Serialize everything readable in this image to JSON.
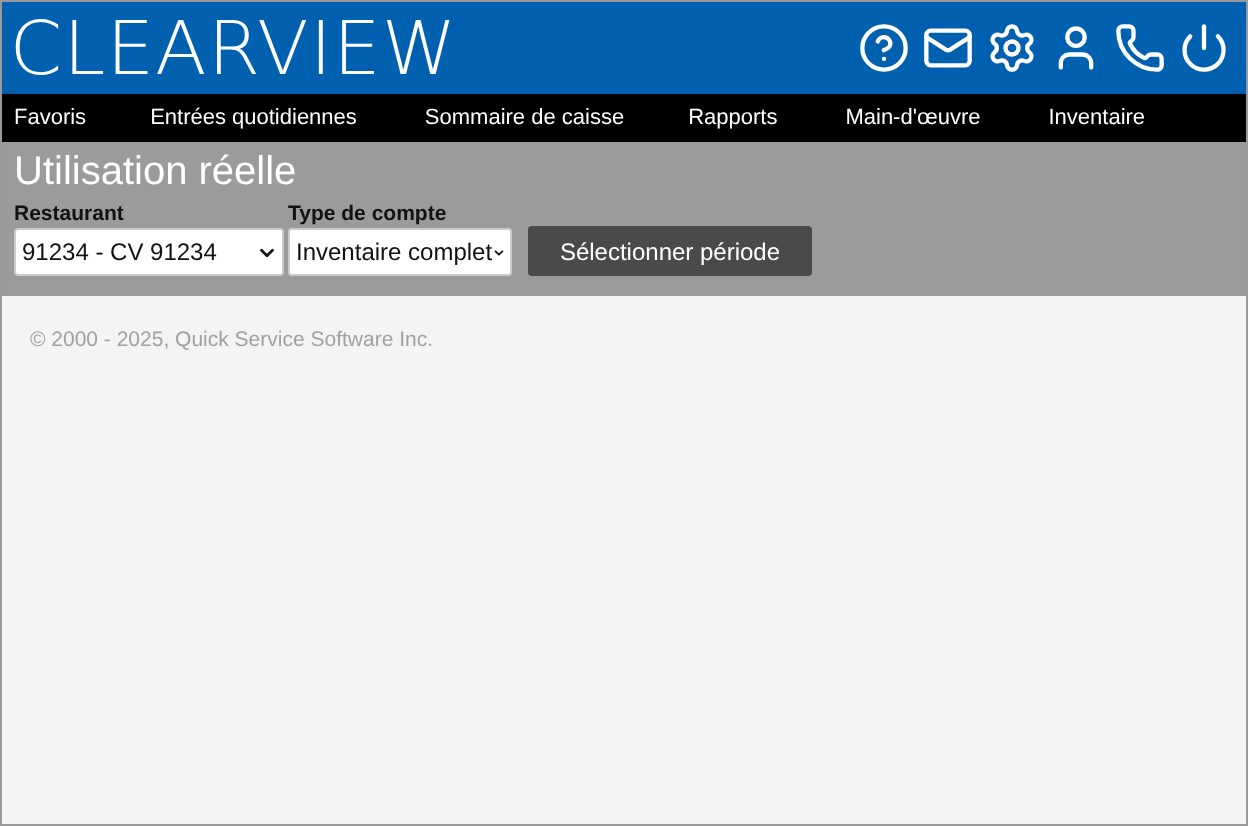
{
  "header": {
    "logo": "CLEARVIEW"
  },
  "nav": [
    {
      "label": "Favoris"
    },
    {
      "label": "Entrées quotidiennes"
    },
    {
      "label": "Sommaire de caisse"
    },
    {
      "label": "Rapports"
    },
    {
      "label": "Main-d'œuvre"
    },
    {
      "label": "Inventaire"
    }
  ],
  "page": {
    "title": "Utilisation réelle"
  },
  "filters": [
    {
      "label": "Restaurant",
      "value": "91234 - CV 91234"
    },
    {
      "label": "Type de compte",
      "value": "Inventaire complet"
    }
  ],
  "button": "Sélectionner période",
  "footer": "© 2000 - 2025, Quick Service Software Inc."
}
